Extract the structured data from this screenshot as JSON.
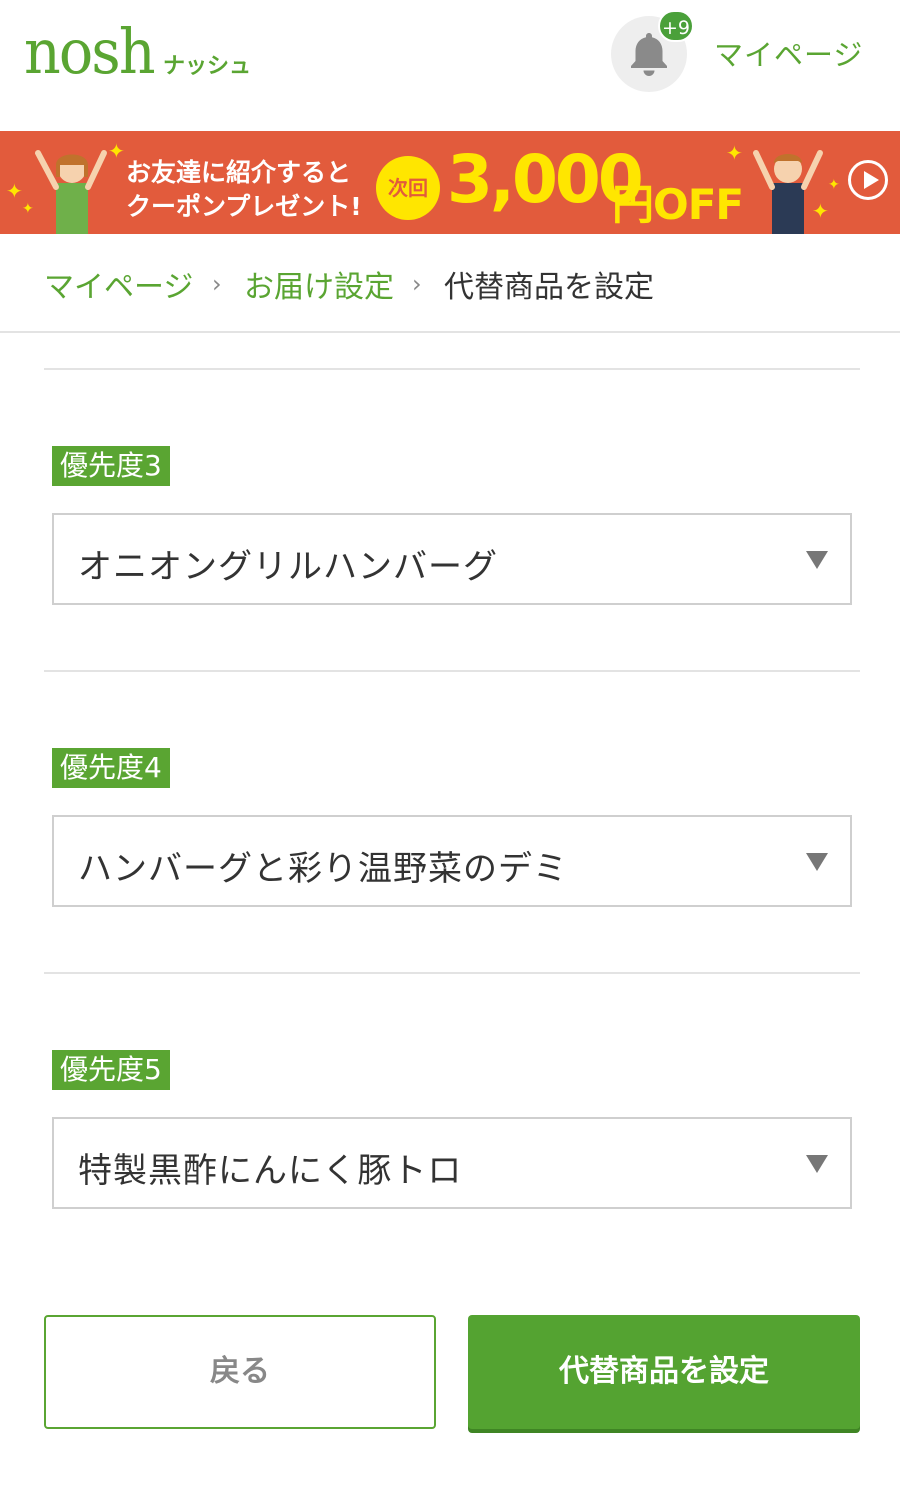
{
  "header": {
    "logo_text": "nosh",
    "logo_sub": "ナッシュ",
    "notification_badge": "+9",
    "mypage_label": "マイページ"
  },
  "banner": {
    "line1": "お友達に紹介すると",
    "line2": "クーポンプレゼント!",
    "next_label": "次回",
    "amount": "3,000",
    "unit_off": "円OFF"
  },
  "breadcrumb": {
    "items": [
      {
        "label": "マイページ"
      },
      {
        "label": "お届け設定"
      },
      {
        "label": "代替商品を設定"
      }
    ]
  },
  "priorities": [
    {
      "label": "優先度3",
      "value": "オニオングリルハンバーグ"
    },
    {
      "label": "優先度4",
      "value": "ハンバーグと彩り温野菜のデミ"
    },
    {
      "label": "優先度5",
      "value": "特製黒酢にんにく豚トロ"
    }
  ],
  "actions": {
    "back_label": "戻る",
    "submit_label": "代替商品を設定"
  },
  "colors": {
    "brand_green": "#5aa532",
    "banner_red": "#e25b3c",
    "banner_yellow": "#ffe600"
  }
}
